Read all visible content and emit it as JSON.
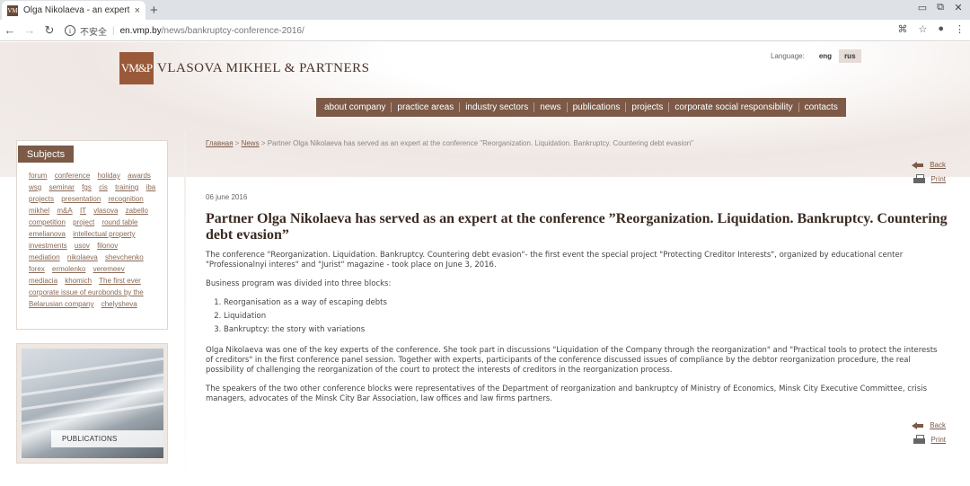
{
  "browser": {
    "tab_title": "Olga Nikolaeva - an expert at",
    "tab_favicon": "VM",
    "tab_close": "×",
    "new_tab": "+",
    "insecure_label": "不安全",
    "url_host": "en.vmp.by",
    "url_path": "/news/bankruptcy-conference-2016/"
  },
  "site": {
    "logo_mark": "VM&P",
    "logo_text": "VLASOVA MIKHEL & PARTNERS",
    "language_label": "Language:",
    "languages": [
      "eng",
      "rus"
    ]
  },
  "nav": {
    "items": [
      "about company",
      "practice areas",
      "industry sectors",
      "news",
      "publications",
      "projects",
      "corporate social responsibility",
      "contacts"
    ]
  },
  "sidebar": {
    "subjects_title": "Subjects",
    "tags": [
      "forum",
      "conference",
      "holiday",
      "awards",
      "wsg",
      "seminar",
      "fgs",
      "cis",
      "training",
      "iba",
      "projects",
      "presentation",
      "recognition",
      "mikhel",
      "m&A",
      "IT",
      "vlasova",
      "zabello",
      "competition",
      "project",
      "round table",
      "emelianova",
      "intellectual property",
      "investments",
      "usov",
      "filonov",
      "mediation",
      "nikolaeva",
      "shevchenko",
      "forex",
      "ermolenko",
      "veremeev",
      "mediacia",
      "khomich",
      "The first ever corporate issue of eurobonds by the Belarusian company",
      "chelysheva"
    ],
    "publications_label": "PUBLICATIONS"
  },
  "breadcrumb": {
    "home": "Главная",
    "sep1": " > ",
    "news": "News",
    "sep2": " > ",
    "current": "Partner Olga Nikolaeva has served as an expert at the conference \"Reorganization. Liquidation. Bankruptcy. Countering debt evasion\""
  },
  "actions": {
    "back": "Back",
    "print": "Print"
  },
  "article": {
    "date": "06 june 2016",
    "title": "Partner Olga Nikolaeva has served as an expert at the conference ”Reorganization. Liquidation. Bankruptcy. Countering debt evasion”",
    "p1": "The conference \"Reorganization. Liquidation. Bankruptcy. Countering debt evasion\"- the first event the special project \"Protecting Creditor Interests\", organized by educational center \"Professionalnyi interes\" and \"Jurist\" magazine - took place  on June 3, 2016.",
    "p2": "Business program was divided into three blocks:",
    "list": [
      "Reorganisation as a way of escaping debts",
      "Liquidation",
      "Bankruptcy: the story with variations"
    ],
    "p3": "Olga Nikolaeva was one of the key experts of the conference. She took part in discussions \"Liquidation of the Company through the reorganization\" and \"Practical tools to protect the interests of creditors\" in the first conference panel session.  Together with experts, participants of the conference discussed issues of compliance by the debtor reorganization procedure, the real possibility of challenging the reorganization of the court to protect the interests of creditors in the reorganization process.",
    "p4": "The speakers of the two other conference blocks were representatives of the Department of reorganization and bankruptcy of Ministry of Economics, Minsk City Executive Committee, crisis managers, advocates of the Minsk City Bar Association, law offices and law firms partners."
  }
}
